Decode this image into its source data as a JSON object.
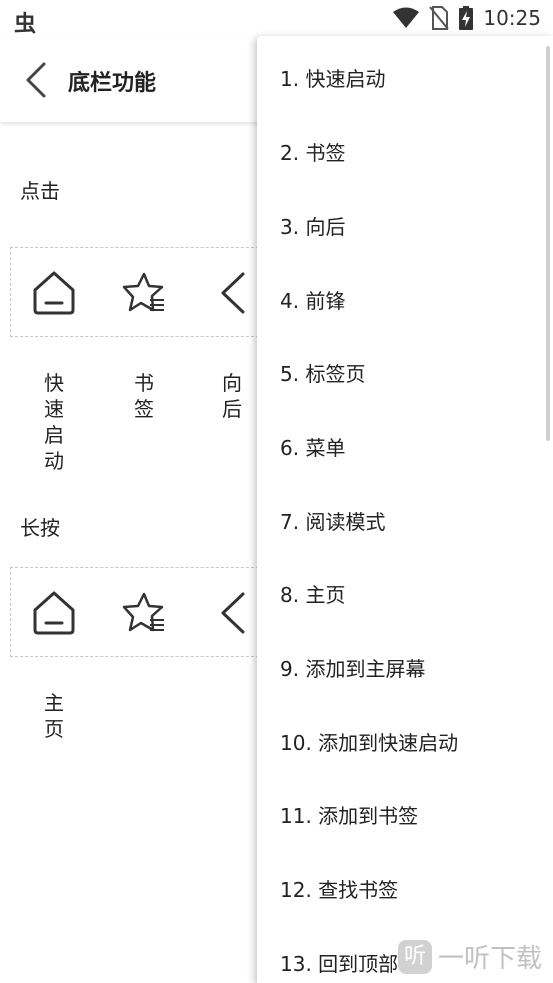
{
  "status_bar": {
    "app_glyph": "虫",
    "time": "10:25"
  },
  "header": {
    "title": "底栏功能"
  },
  "sections": {
    "click_label": "点击",
    "long_press_label": "长按"
  },
  "click_row": {
    "labels": [
      "快速启动",
      "书签",
      "向后"
    ]
  },
  "long_press_row": {
    "labels": [
      "主页"
    ]
  },
  "menu": {
    "items": [
      "1. 快速启动",
      "2. 书签",
      "3. 向后",
      "4. 前锋",
      "5. 标签页",
      "6. 菜单",
      "7. 阅读模式",
      "8. 主页",
      "9. 添加到主屏幕",
      "10. 添加到快速启动",
      "11. 添加到书签",
      "12. 查找书签",
      "13. 回到顶部"
    ]
  },
  "watermark": {
    "glyph": "听",
    "text": "一听下载"
  },
  "icons": [
    "wifi-icon",
    "no-sim-icon",
    "battery-charging-icon",
    "back-arrow-icon",
    "home-icon",
    "bookmark-star-icon",
    "chevron-left-icon"
  ]
}
